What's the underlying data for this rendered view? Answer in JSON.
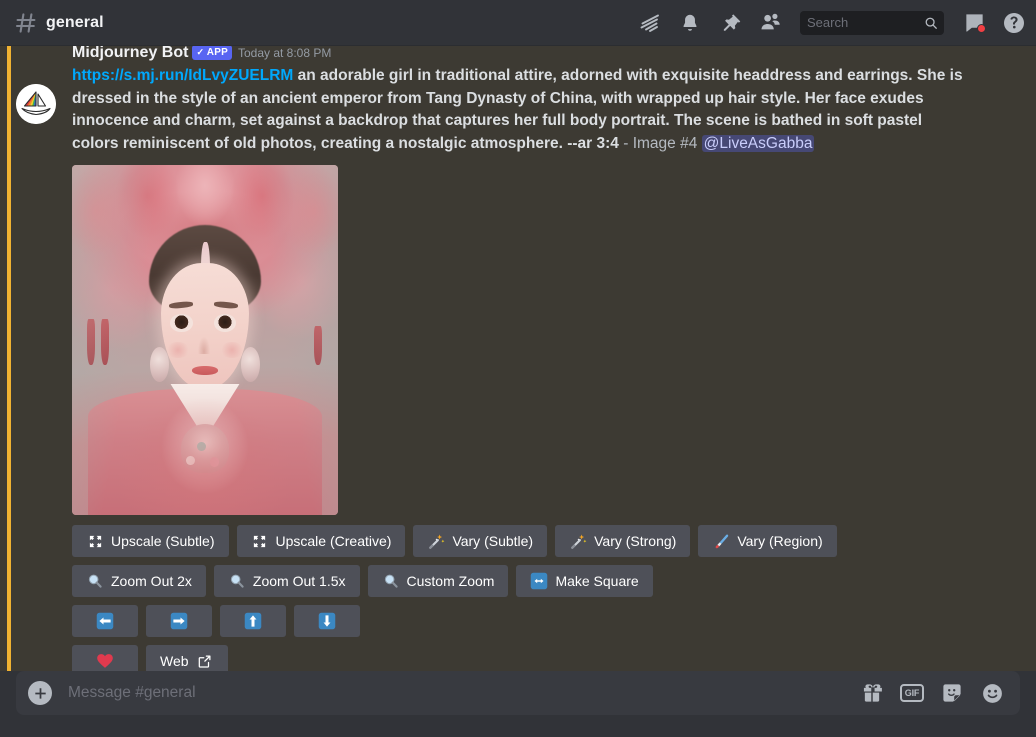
{
  "header": {
    "hash_icon": "hash-icon",
    "channel_name": "general",
    "icons": [
      {
        "name": "threads-icon",
        "label": "Threads"
      },
      {
        "name": "notification-bell-icon",
        "label": "Notification Settings"
      },
      {
        "name": "pinned-messages-icon",
        "label": "Pinned Messages"
      },
      {
        "name": "member-list-icon",
        "label": "Show Member List"
      }
    ],
    "search": {
      "placeholder": "Search",
      "value": "",
      "icon": "search-icon"
    },
    "inbox": {
      "name": "inbox-icon",
      "has_unread": true,
      "dot_color": "#f23f43"
    },
    "help": {
      "name": "help-icon",
      "glyph": "?"
    }
  },
  "message": {
    "author": "Midjourney Bot",
    "badge": "APP",
    "badge_check": "✓",
    "timestamp": "Today at 8:08 PM",
    "avatar_name": "midjourney-avatar",
    "link_text": "https://s.mj.run/IdLvyZUELRM",
    "prompt_text": " an adorable girl in traditional attire, adorned with exquisite headdress and earrings. She is dressed in the style of an ancient emperor from Tang Dynasty of China, with wrapped up hair style. Her face exudes innocence and charm, set against a backdrop that captures her full body portrait. The scene is bathed in soft pastel colors reminiscent of old photos, creating a nostalgic atmosphere. --ar 3:4",
    "suffix_text": " - Image #4 ",
    "mention": "@LiveAsGabba",
    "highlight_color": "#f0b232",
    "attachment_name": "generated-image-attachment"
  },
  "action_rows": [
    {
      "row": "upscale-vary-row",
      "buttons": [
        {
          "name": "upscale-subtle-button",
          "label": "Upscale (Subtle)",
          "icon": "expand-arrows-icon"
        },
        {
          "name": "upscale-creative-button",
          "label": "Upscale (Creative)",
          "icon": "expand-arrows-icon"
        },
        {
          "name": "vary-subtle-button",
          "label": "Vary (Subtle)",
          "icon": "magic-wand-icon"
        },
        {
          "name": "vary-strong-button",
          "label": "Vary (Strong)",
          "icon": "magic-wand-icon"
        },
        {
          "name": "vary-region-button",
          "label": "Vary (Region)",
          "icon": "paintbrush-icon"
        }
      ]
    },
    {
      "row": "zoom-row",
      "buttons": [
        {
          "name": "zoom-out-2x-button",
          "label": "Zoom Out 2x",
          "icon": "magnifying-glass-icon"
        },
        {
          "name": "zoom-out-1-5x-button",
          "label": "Zoom Out 1.5x",
          "icon": "magnifying-glass-icon"
        },
        {
          "name": "custom-zoom-button",
          "label": "Custom Zoom",
          "icon": "magnifying-glass-icon"
        },
        {
          "name": "make-square-button",
          "label": "Make Square",
          "icon": "left-right-arrow-icon"
        }
      ]
    },
    {
      "row": "pan-row",
      "buttons": [
        {
          "name": "pan-left-button",
          "label": "",
          "icon": "arrow-left-icon"
        },
        {
          "name": "pan-right-button",
          "label": "",
          "icon": "arrow-right-icon"
        },
        {
          "name": "pan-up-button",
          "label": "",
          "icon": "arrow-up-icon"
        },
        {
          "name": "pan-down-button",
          "label": "",
          "icon": "arrow-down-icon"
        }
      ]
    },
    {
      "row": "favorite-web-row",
      "buttons": [
        {
          "name": "favorite-button",
          "label": "",
          "icon": "heart-icon"
        },
        {
          "name": "web-button",
          "label": "Web",
          "icon": "external-link-icon"
        }
      ]
    }
  ],
  "composer": {
    "placeholder": "Message #general",
    "value": "",
    "add_button": {
      "name": "add-attachment-button",
      "glyph": "+"
    },
    "icons": [
      {
        "name": "gift-icon",
        "label": "Gift"
      },
      {
        "name": "gif-icon",
        "label": "GIF"
      },
      {
        "name": "sticker-icon",
        "label": "Sticker"
      },
      {
        "name": "emoji-icon",
        "label": "Emoji"
      }
    ]
  },
  "theme": {
    "app_bg": "#313338",
    "header_bg": "#313338",
    "message_highlight_bg": "#3d3a33",
    "accent": "#5865f2",
    "link": "#00a8fc",
    "button_bg": "#4e5058"
  }
}
